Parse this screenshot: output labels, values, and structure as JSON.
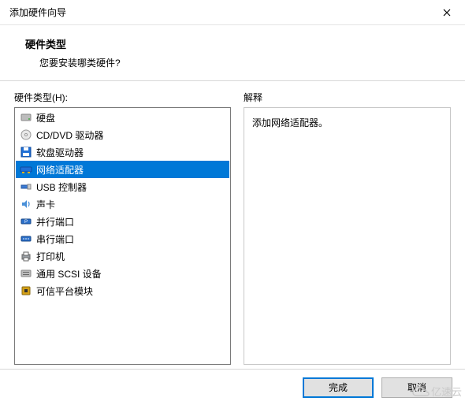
{
  "window": {
    "title": "添加硬件向导"
  },
  "header": {
    "title": "硬件类型",
    "subtitle": "您要安装哪类硬件?"
  },
  "left": {
    "label": "硬件类型(H):",
    "items": [
      {
        "icon": "hdd-icon",
        "label": "硬盘",
        "selected": false
      },
      {
        "icon": "cd-icon",
        "label": "CD/DVD 驱动器",
        "selected": false
      },
      {
        "icon": "floppy-icon",
        "label": "软盘驱动器",
        "selected": false
      },
      {
        "icon": "network-icon",
        "label": "网络适配器",
        "selected": true
      },
      {
        "icon": "usb-icon",
        "label": "USB 控制器",
        "selected": false
      },
      {
        "icon": "sound-icon",
        "label": "声卡",
        "selected": false
      },
      {
        "icon": "parallel-icon",
        "label": "并行端口",
        "selected": false
      },
      {
        "icon": "serial-icon",
        "label": "串行端口",
        "selected": false
      },
      {
        "icon": "printer-icon",
        "label": "打印机",
        "selected": false
      },
      {
        "icon": "scsi-icon",
        "label": "通用 SCSI 设备",
        "selected": false
      },
      {
        "icon": "tpm-icon",
        "label": "可信平台模块",
        "selected": false
      }
    ]
  },
  "right": {
    "label": "解释",
    "description": "添加网络适配器。"
  },
  "footer": {
    "finish": "完成",
    "cancel": "取消"
  },
  "watermark": "亿速云"
}
